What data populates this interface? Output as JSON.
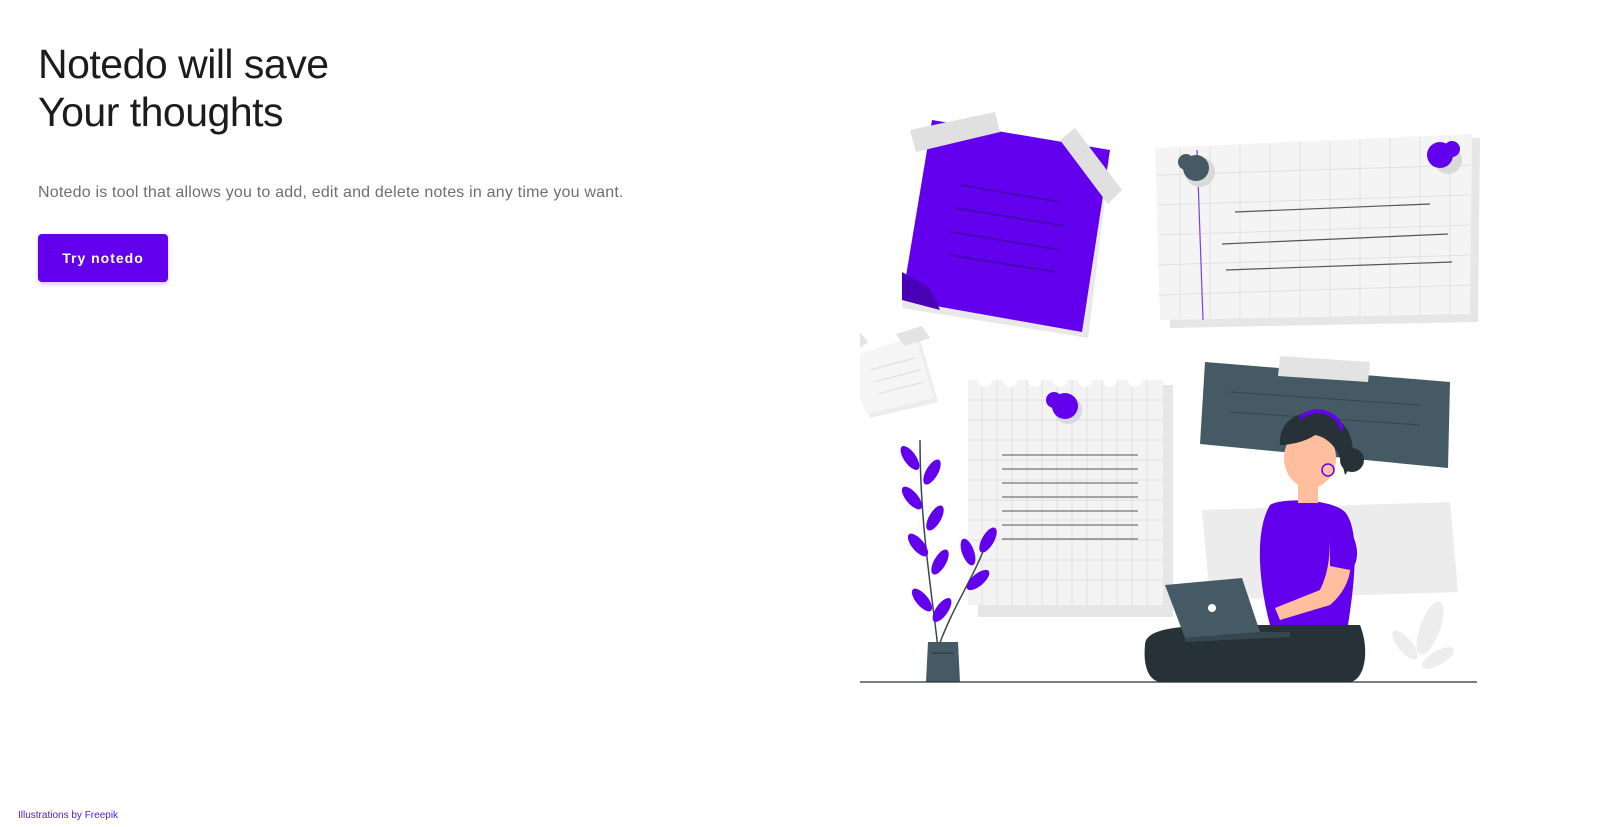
{
  "hero": {
    "headline_line1": "Notedo will save",
    "headline_line2": "Your thoughts",
    "subtitle": "Notedo is tool that allows you to add, edit and delete notes in any time you want.",
    "cta_label": "Try notedo"
  },
  "footer": {
    "credit": "Illustrations by Freepik"
  },
  "colors": {
    "accent": "#6200ee",
    "text_dark": "#1c1c1c",
    "text_muted": "#6f6f6f",
    "slate": "#455a64"
  },
  "illustration": {
    "icon": "notes-illustration"
  }
}
